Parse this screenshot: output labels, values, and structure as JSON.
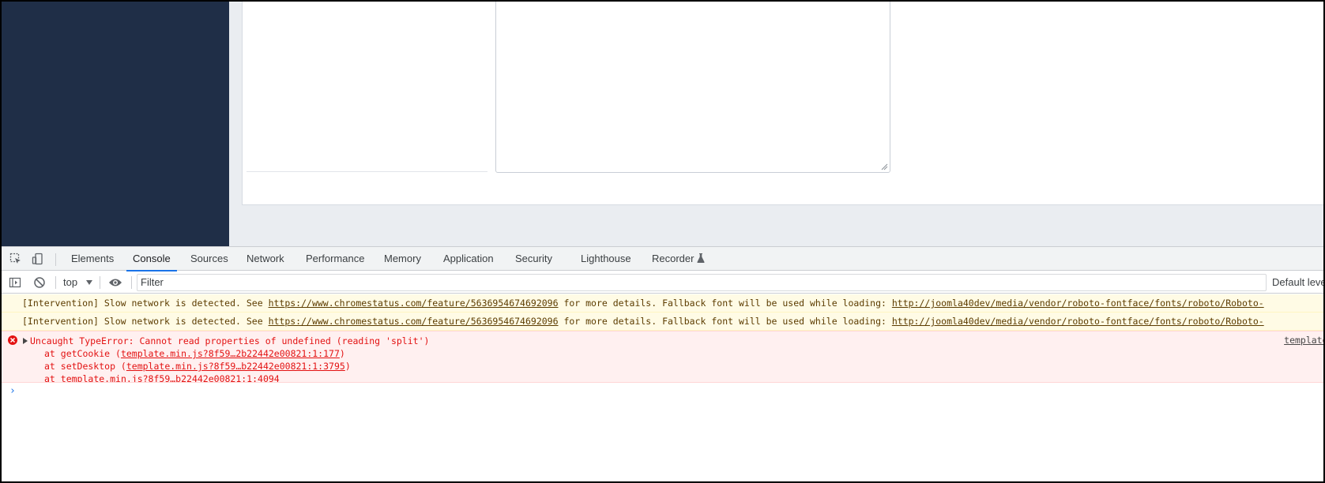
{
  "devtools": {
    "tabs": [
      {
        "label": "Elements",
        "active": false
      },
      {
        "label": "Console",
        "active": true
      },
      {
        "label": "Sources",
        "active": false
      },
      {
        "label": "Network",
        "active": false
      },
      {
        "label": "Performance",
        "active": false
      },
      {
        "label": "Memory",
        "active": false
      },
      {
        "label": "Application",
        "active": false
      },
      {
        "label": "Security",
        "active": false
      },
      {
        "label": "Lighthouse",
        "active": false
      },
      {
        "label": "Recorder",
        "active": false
      }
    ],
    "toolbar": {
      "context": "top",
      "filter_placeholder": "Filter",
      "levels": "Default levels"
    }
  },
  "console": {
    "warnings": [
      {
        "prefix": "[Intervention] Slow network is detected. See ",
        "link": "https://www.chromestatus.com/feature/5636954674692096",
        "middle": " for more details. Fallback font will be used while loading: ",
        "url": "http://joomla40dev/media/vendor/roboto-fontface/fonts/roboto/Roboto-"
      },
      {
        "prefix": "[Intervention] Slow network is detected. See ",
        "link": "https://www.chromestatus.com/feature/5636954674692096",
        "middle": " for more details. Fallback font will be used while loading: ",
        "url": "http://joomla40dev/media/vendor/roboto-fontface/fonts/roboto/Roboto-"
      }
    ],
    "error": {
      "message": "Uncaught TypeError: Cannot read properties of undefined (reading 'split')",
      "source": "template.min.js",
      "stack": [
        {
          "prefix": "at getCookie (",
          "link": "template.min.js?8f59…2b22442e00821:1:177",
          "suffix": ")"
        },
        {
          "prefix": "at setDesktop (",
          "link": "template.min.js?8f59…b22442e00821:1:3795",
          "suffix": ")"
        },
        {
          "prefix": "at ",
          "link": "template.min.js?8f59…b22442e00821:1:4094",
          "suffix": ""
        }
      ]
    },
    "prompt_symbol": "›"
  },
  "colors": {
    "sidebar": "#1f2e47",
    "active_tab_underline": "#1a73e8",
    "warning_bg": "#fffbe5",
    "error_bg": "#fff0f0",
    "error_text": "#e31212"
  }
}
